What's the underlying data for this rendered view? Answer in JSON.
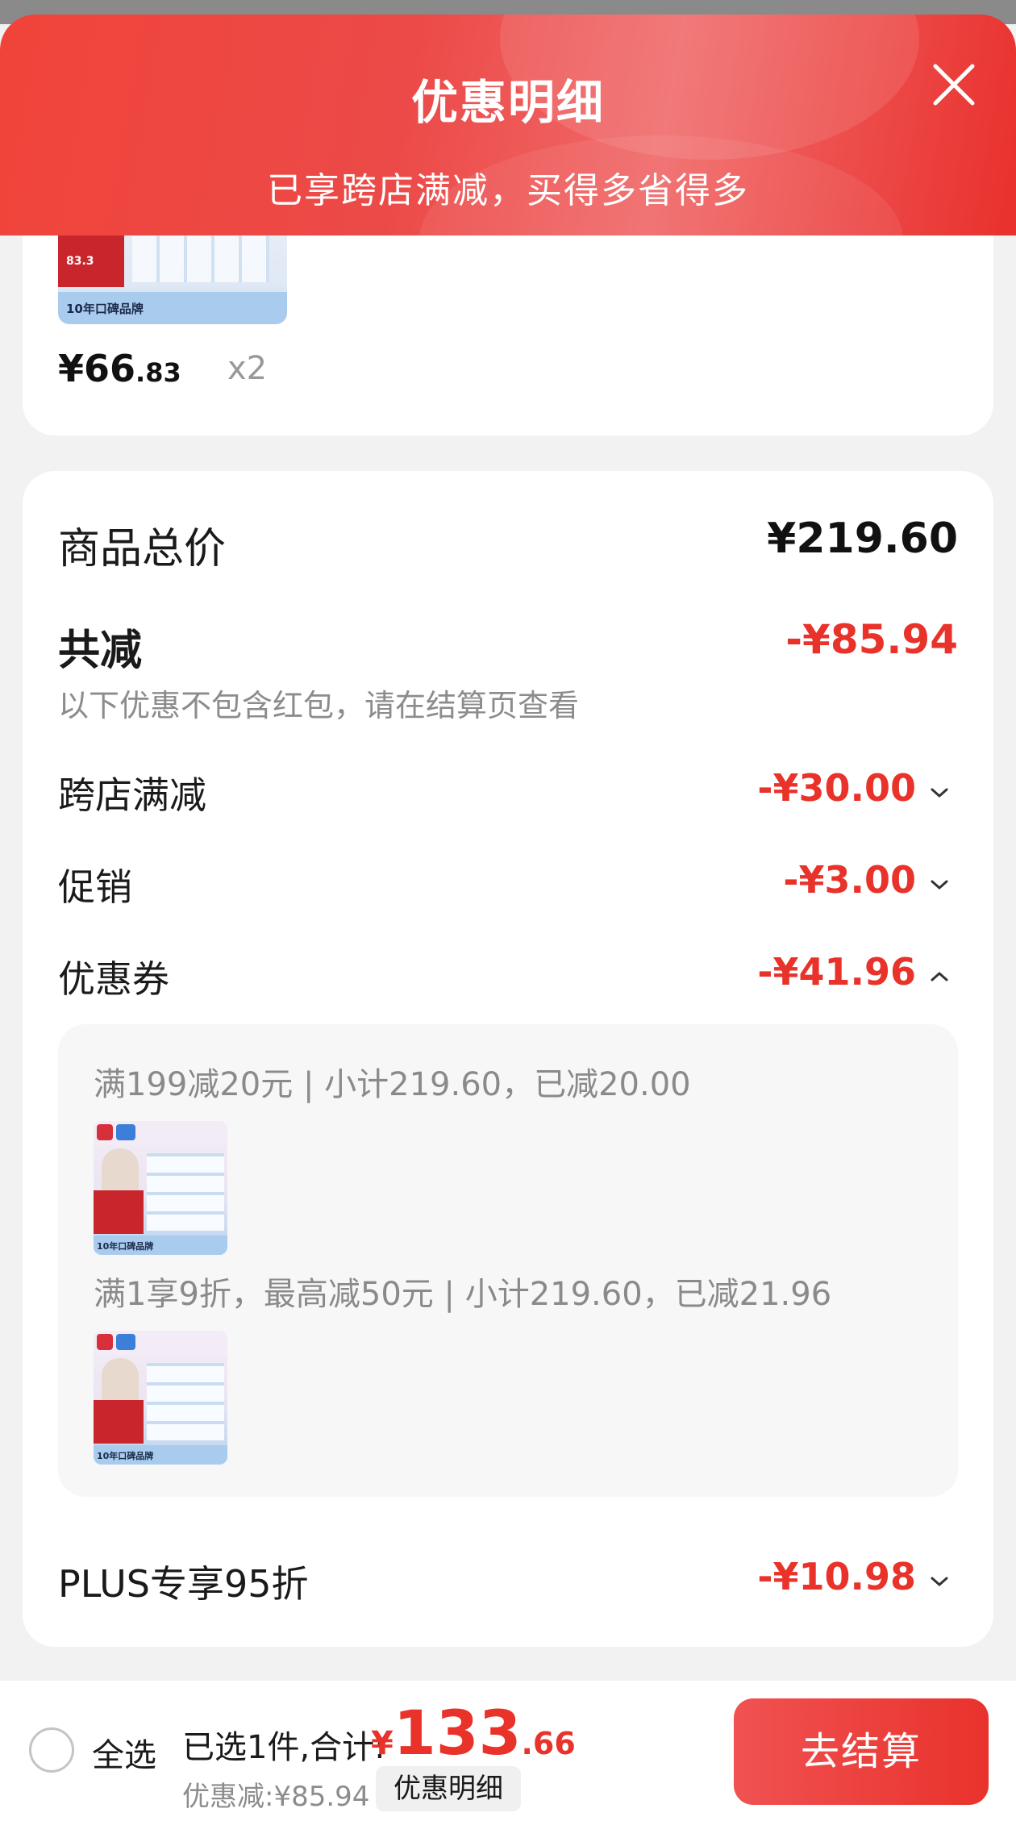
{
  "header": {
    "title": "优惠明细",
    "subtitle": "已享跨店满减，买得多省得多"
  },
  "product": {
    "thumb_badge": "83.3",
    "thumb_caption": "10年口碑品牌",
    "price_currency": "¥",
    "price_integer": "66",
    "price_decimal": ".83",
    "quantity": "x2"
  },
  "summary": {
    "total_label": "商品总价",
    "total_value": "¥219.60",
    "reduce_label": "共减",
    "reduce_value": "-¥85.94",
    "note": "以下优惠不包含红包，请在结算页查看",
    "items": [
      {
        "label": "跨店满减",
        "value": "-¥30.00",
        "expanded": false
      },
      {
        "label": "促销",
        "value": "-¥3.00",
        "expanded": false
      },
      {
        "label": "优惠券",
        "value": "-¥41.96",
        "expanded": true
      },
      {
        "label": "PLUS专享95折",
        "value": "-¥10.98",
        "expanded": false
      }
    ],
    "coupons": [
      {
        "text": "满199减20元 | 小计219.60，已减20.00",
        "thumb_caption": "10年口碑品牌"
      },
      {
        "text": "满1享9折，最高减50元 | 小计219.60，已减21.96",
        "thumb_caption": "10年口碑品牌"
      }
    ]
  },
  "bottom_bar": {
    "select_all": "全选",
    "selected_info": "已选1件,合计:",
    "total_currency": "¥",
    "total_integer": "133",
    "total_decimal": ".66",
    "discount_info": "优惠减:¥85.94",
    "detail_chip": "优惠明细",
    "checkout": "去结算"
  },
  "colors": {
    "accent_red": "#e8322a",
    "header_red": "#ec4a48",
    "muted_text": "#8c8c8c"
  },
  "icons": {
    "close": "close-icon",
    "collapsed": "chevron-down-icon",
    "expanded": "chevron-up-icon",
    "checkbox": "radio-circle-icon"
  }
}
